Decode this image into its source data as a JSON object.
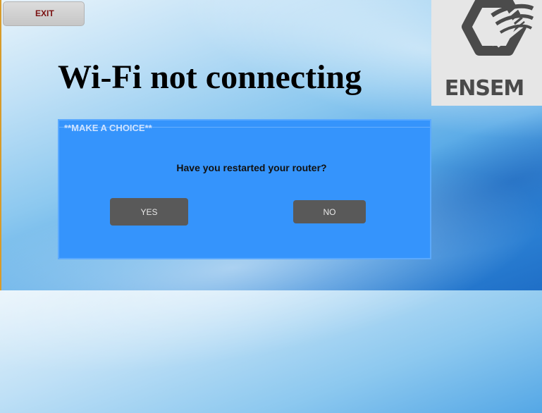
{
  "toolbar": {
    "exit_label": "EXIT"
  },
  "header": {
    "title": "Wi-Fi not connecting"
  },
  "logo": {
    "text": "ENSEM",
    "icon": "ensem-logo-icon"
  },
  "panel": {
    "header": "**MAKE A CHOICE**",
    "question": "Have you restarted your router?",
    "yes_label": "YES",
    "no_label": "NO"
  },
  "colors": {
    "panel_bg": "#3594fc",
    "button_bg": "#595959",
    "exit_text": "#7a1010",
    "logo_bg": "#e6e6e6"
  }
}
